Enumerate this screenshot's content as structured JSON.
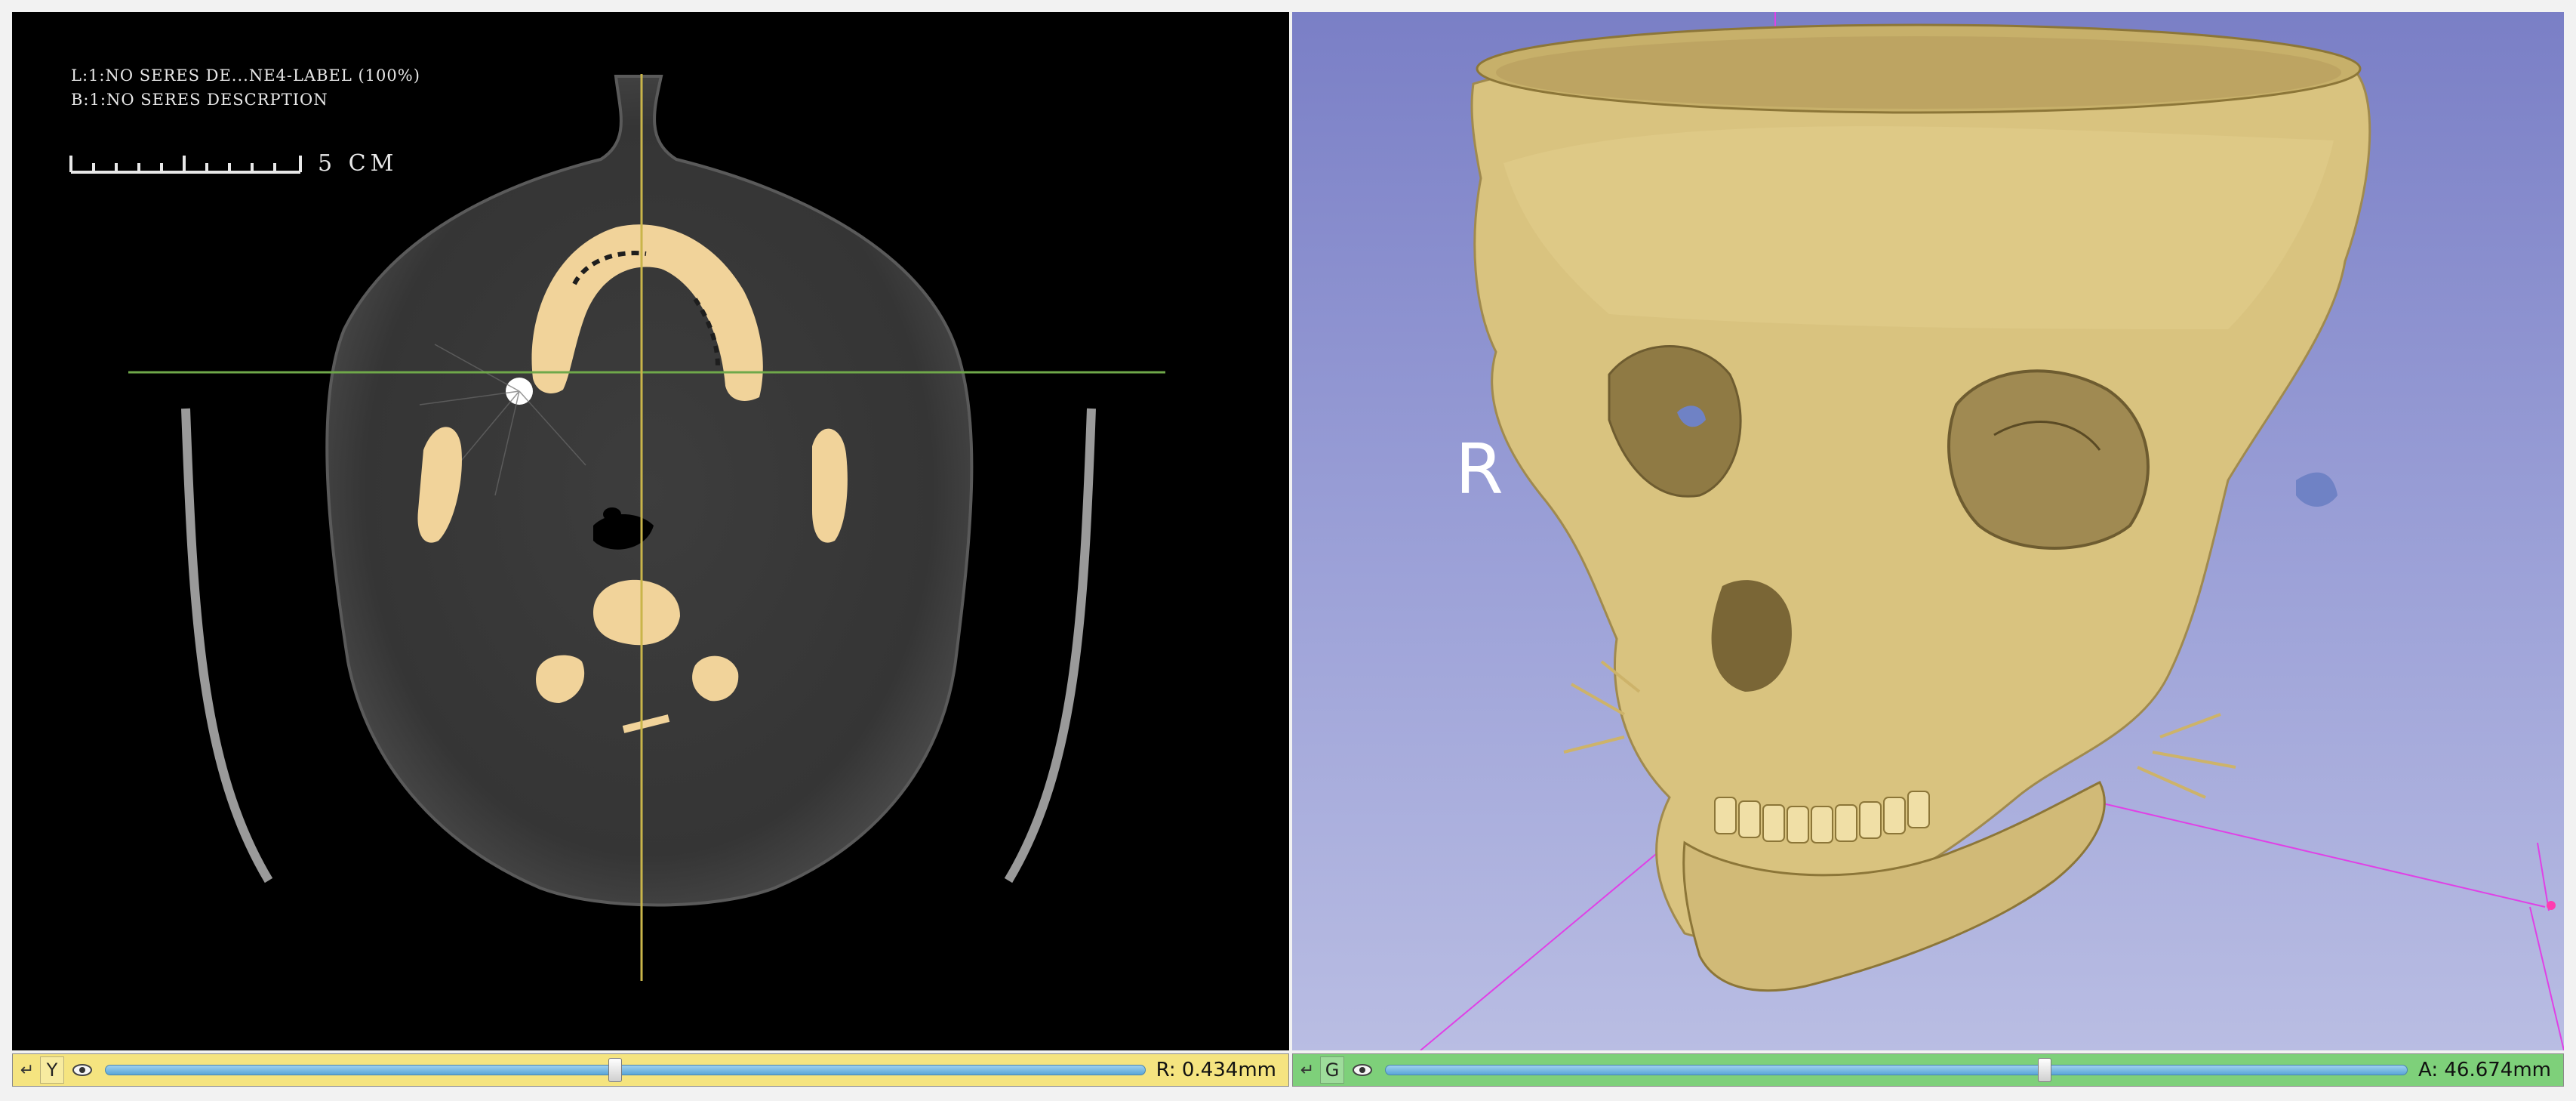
{
  "slice_view": {
    "corner_annotations": {
      "line1": "L:1:NO SERES DE...NE4-LABEL (100%)",
      "line2": "B:1:NO SERES DESCRPTION"
    },
    "scale_ruler": {
      "label": "5 CM"
    },
    "colors": {
      "crosshair_horizontal": "#6fa84a",
      "crosshair_vertical": "#c9b54a",
      "bone_label": "#f1d39a",
      "soft_tissue": "#3b3b3b"
    }
  },
  "threed_view": {
    "orientation_label": "R",
    "colors": {
      "background_top": "#7a7fc6",
      "background_bottom": "#b9bde3",
      "skull": "#d9c37f",
      "axes": "#e040e6",
      "marker": "#ff3db0"
    }
  },
  "slice_controllers": [
    {
      "view_letter": "Y",
      "offset": "R: 0.434mm",
      "slider_fraction": 0.49,
      "bar_color": "#f5e480"
    },
    {
      "view_letter": "G",
      "offset": "A: 46.674mm",
      "slider_fraction": 0.645,
      "bar_color": "#7ed07a"
    }
  ],
  "icons": {
    "pin": "pin-icon",
    "visibility": "eye-icon"
  }
}
